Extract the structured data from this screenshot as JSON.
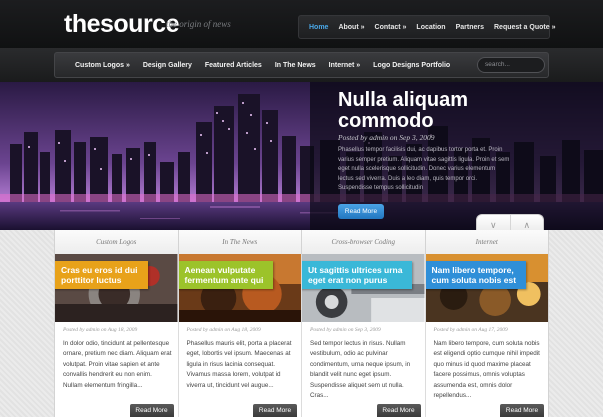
{
  "header": {
    "logo": "thesource",
    "tagline": "the origin of news",
    "nav": [
      {
        "label": "Home",
        "active": true,
        "submenu": false
      },
      {
        "label": "About",
        "active": false,
        "submenu": true
      },
      {
        "label": "Contact",
        "active": false,
        "submenu": true
      },
      {
        "label": "Location",
        "active": false,
        "submenu": false
      },
      {
        "label": "Partners",
        "active": false,
        "submenu": false
      },
      {
        "label": "Request a Quote",
        "active": false,
        "submenu": true
      }
    ]
  },
  "catnav": {
    "items": [
      {
        "label": "Custom Logos",
        "submenu": true
      },
      {
        "label": "Design Gallery",
        "submenu": false
      },
      {
        "label": "Featured Articles",
        "submenu": false
      },
      {
        "label": "In The News",
        "submenu": false
      },
      {
        "label": "Internet",
        "submenu": true
      },
      {
        "label": "Logo Designs Portfolio",
        "submenu": false
      }
    ],
    "search_placeholder": "search..."
  },
  "hero": {
    "title": "Nulla aliquam commodo",
    "meta": "Posted by admin on Sep 3, 2009",
    "text": "Phasellus tempor facilisis dui, ac dapibus tortor porta et. Proin varius semper pretium. Aliquam vitae sagittis ligula. Proin et sem eget nulla scelerisque sollicitudin. Donec varius elementum lectus sed viverra. Duis a leo diam, quis tempor orci. Suspendisse tempus sollicitudin",
    "button": "Read More",
    "arrow_down": "∨",
    "arrow_up": "∧"
  },
  "tabs": [
    "Custom Logos",
    "In The News",
    "Cross-browser Coding",
    "Internet"
  ],
  "cards": [
    {
      "label_line1": "Cras eu eros id dui",
      "label_line2": "porttitor luctus",
      "label_color": "#e8a21a",
      "meta": "Posted by admin on Aug 18, 2009",
      "text": "In dolor odio, tincidunt at pellentesque ornare, pretium nec diam. Aliquam erat volutpat. Proin vitae sapien et ante convallis hendrerit eu non enim. Nullam elementum fringilla...",
      "button": "Read More"
    },
    {
      "label_line1": "Aenean vulputate",
      "label_line2": "fermentum ante qui",
      "label_color": "#9cc32a",
      "meta": "Posted by admin on Aug 18, 2009",
      "text": "Phasellus mauris elit, porta a placerat eget, lobortis vel ipsum. Maecenas at ligula in risus lacinia consequat. Vivamus massa lorem, volutpat id viverra ut, tincidunt vel augue...",
      "button": "Read More"
    },
    {
      "label_line1": "Ut sagittis ultrices urna",
      "label_line2": "eget erat non purus",
      "label_color": "#3ab8d8",
      "meta": "Posted by admin on Sep 3, 2009",
      "text": "Sed tempor lectus in risus. Nullam vestibulum, odio ac pulvinar condimentum, urna neque ipsum, in blandit velit nunc eget ipsum. Suspendisse aliquet sem ut nulla. Cras...",
      "button": "Read More"
    },
    {
      "label_line1": "Nam libero tempore,",
      "label_line2": "cum soluta nobis est",
      "label_color": "#2f8fd8",
      "meta": "Posted by admin on Aug 17, 2009",
      "text": "Nam libero tempore, cum soluta nobis est eligendi optio cumque nihil impedit quo minus id quod maxime placeat facere possimus, omnis voluptas assumenda est, omnis dolor repellendus...",
      "button": "Read More"
    }
  ]
}
